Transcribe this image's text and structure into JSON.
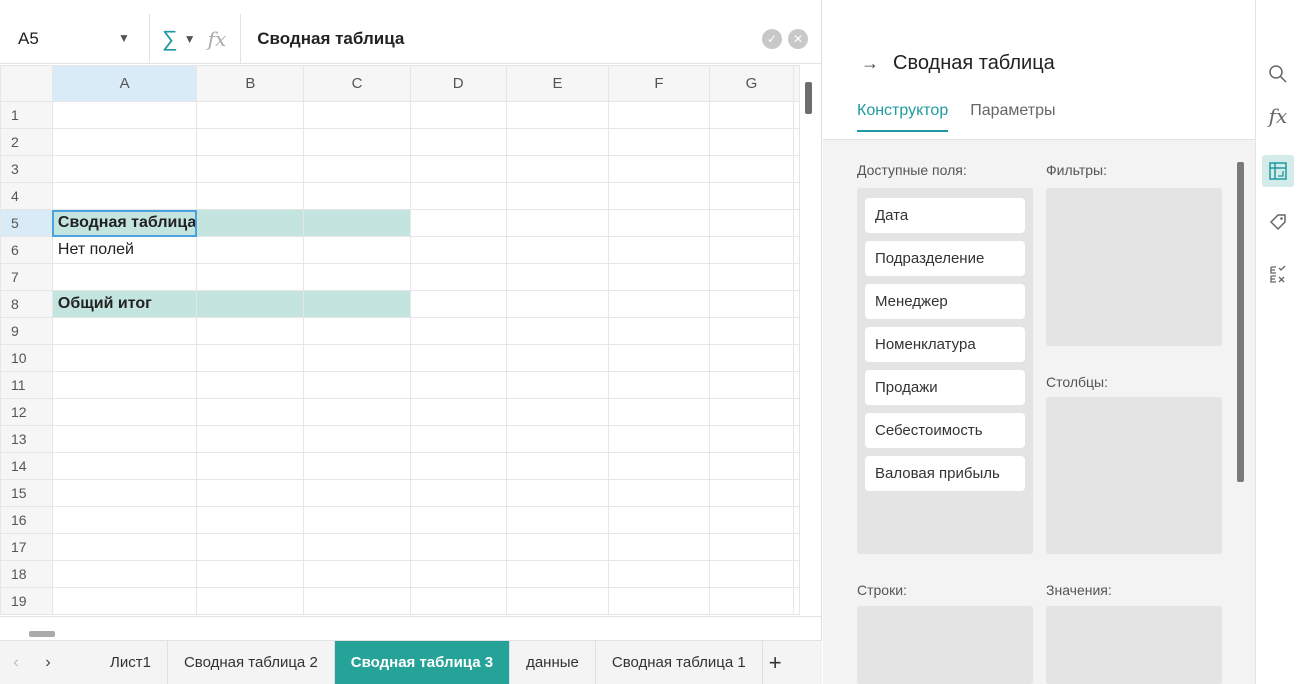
{
  "formula_bar": {
    "cell_ref": "A5",
    "sum_symbol": "∑",
    "fx_symbol": "fx",
    "formula": "Сводная таблица"
  },
  "grid": {
    "columns": [
      "A",
      "B",
      "C",
      "D",
      "E",
      "F",
      "G"
    ],
    "rows": [
      "1",
      "2",
      "3",
      "4",
      "5",
      "6",
      "7",
      "8",
      "9",
      "10",
      "11",
      "12",
      "13",
      "14",
      "15",
      "16",
      "17",
      "18",
      "19"
    ],
    "selected_cell": "A5",
    "cells": {
      "5": "Сводная таблица",
      "6": "Нет полей",
      "8": "Общий итог"
    },
    "band_color": "#c3e4df"
  },
  "sheet_tabs": [
    {
      "label": "Лист1",
      "active": false
    },
    {
      "label": "Сводная таблица 2",
      "active": false
    },
    {
      "label": "Сводная таблица 3",
      "active": true
    },
    {
      "label": "данные",
      "active": false
    },
    {
      "label": "Сводная таблица 1",
      "active": false
    }
  ],
  "add_tab": "+",
  "panel": {
    "title": "Сводная таблица",
    "tabs": [
      {
        "label": "Конструктор",
        "active": true
      },
      {
        "label": "Параметры",
        "active": false
      }
    ],
    "available_label": "Доступные поля:",
    "filters_label": "Фильтры:",
    "columns_label": "Столбцы:",
    "rows_label": "Строки:",
    "values_label": "Значения:",
    "fields": [
      "Дата",
      "Подразделение",
      "Менеджер",
      "Номенклатура",
      "Продажи",
      "Себестоимость",
      "Валовая прибыль"
    ]
  },
  "colors": {
    "accent": "#1e9aa0",
    "active_tab": "#26a398"
  },
  "strip_icons": [
    "search-icon",
    "function-icon",
    "pivot-table-icon",
    "tag-icon",
    "check-list-icon"
  ]
}
